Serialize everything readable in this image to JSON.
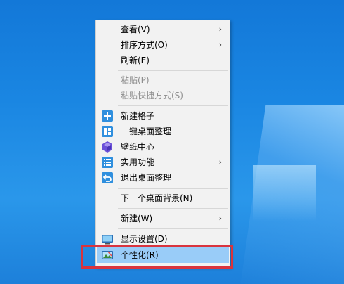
{
  "menu": {
    "items": [
      {
        "label": "查看(V)",
        "submenu": true,
        "arrow": "›"
      },
      {
        "label": "排序方式(O)",
        "submenu": true,
        "arrow": "›"
      },
      {
        "label": "刷新(E)"
      },
      {
        "label": "粘贴(P)",
        "disabled": true
      },
      {
        "label": "粘贴快捷方式(S)",
        "disabled": true
      },
      {
        "label": "新建格子",
        "icon": "plus-square-icon"
      },
      {
        "label": "一键桌面整理",
        "icon": "grid-layout-icon"
      },
      {
        "label": "壁纸中心",
        "icon": "cube-icon"
      },
      {
        "label": "实用功能",
        "icon": "list-icon",
        "submenu": true,
        "arrow": "›"
      },
      {
        "label": "退出桌面整理",
        "icon": "exit-icon"
      },
      {
        "label": "下一个桌面背景(N)"
      },
      {
        "label": "新建(W)",
        "submenu": true,
        "arrow": "›"
      },
      {
        "label": "显示设置(D)",
        "icon": "monitor-icon"
      },
      {
        "label": "个性化(R)",
        "icon": "personalize-icon",
        "highlighted": true
      }
    ]
  },
  "colors": {
    "menu_bg": "#f2f2f2",
    "highlight": "#99ccf8",
    "callout": "#d9343e",
    "icon_blue": "#2f8fde",
    "icon_purple": "#6a4fd8",
    "desktop": "#1a86e2"
  }
}
